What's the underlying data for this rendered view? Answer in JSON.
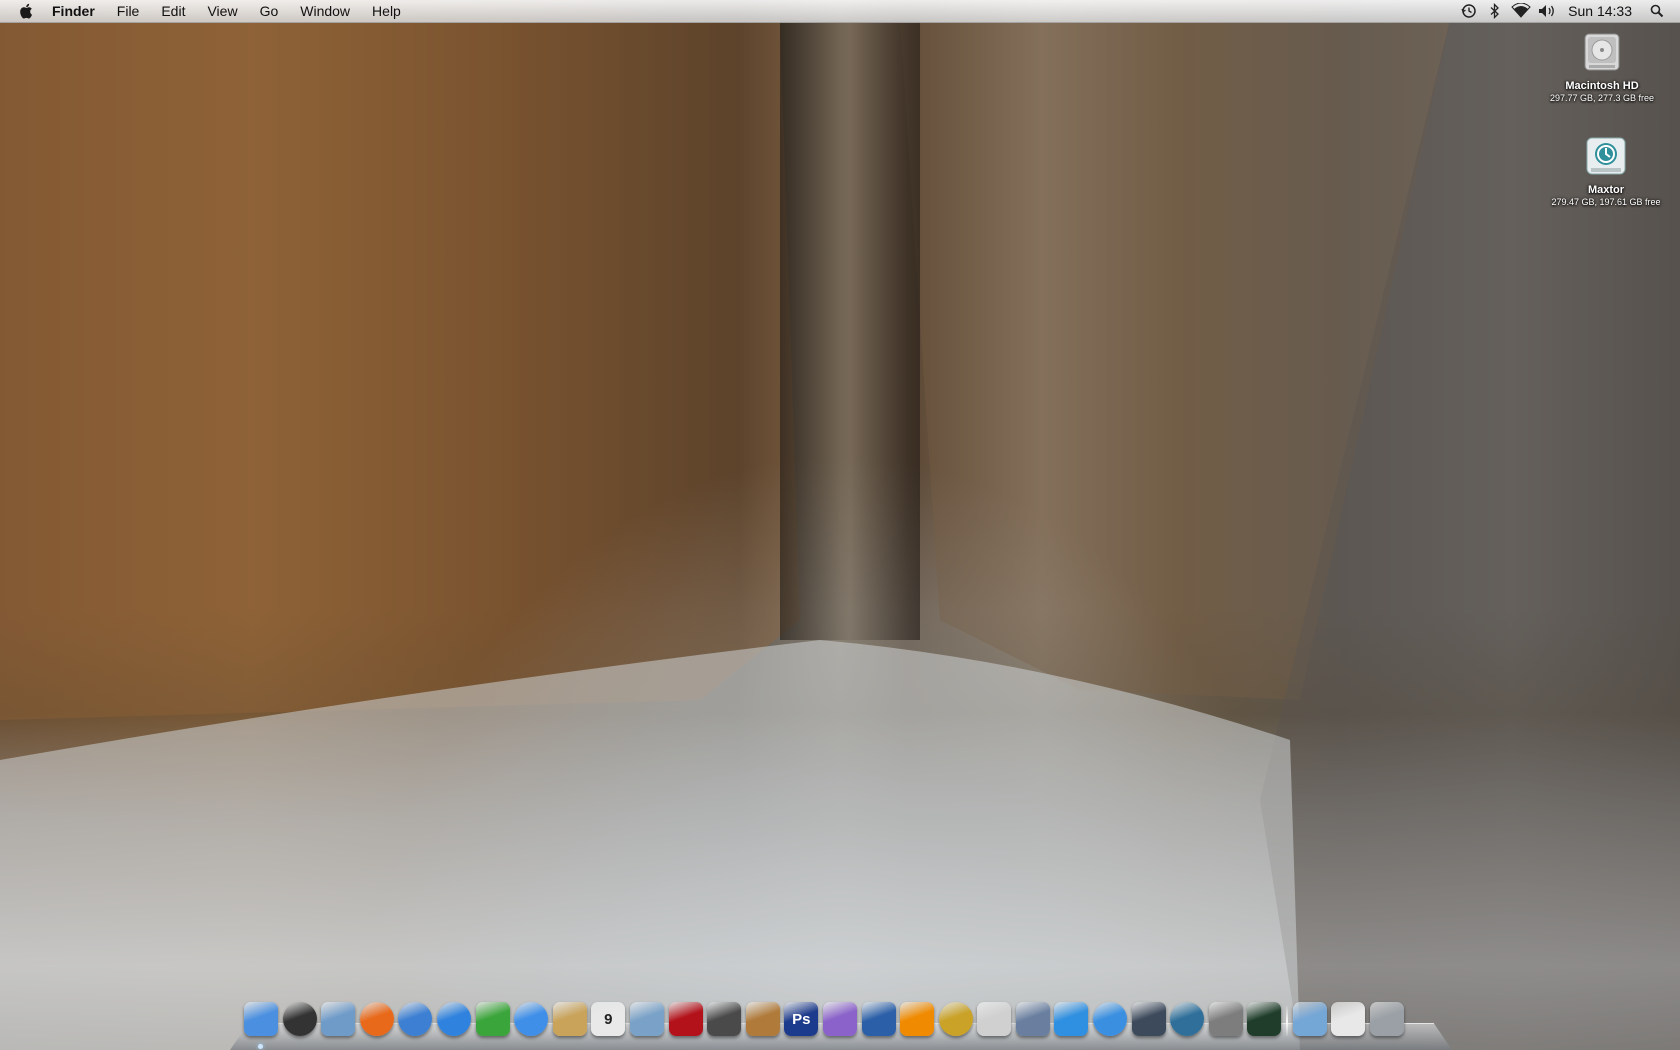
{
  "menubar": {
    "apple_icon": "apple-logo-icon",
    "app_name": "Finder",
    "menus": [
      "File",
      "Edit",
      "View",
      "Go",
      "Window",
      "Help"
    ],
    "status_icons": [
      "time-machine-icon",
      "bluetooth-icon",
      "wifi-icon",
      "volume-icon"
    ],
    "clock": "Sun 14:33",
    "spotlight_icon": "spotlight-search-icon"
  },
  "desktop": {
    "wallpaper": "narrows-canyon-river",
    "drives": [
      {
        "name": "Macintosh HD",
        "info": "297.77 GB, 277.3 GB free",
        "icon": "hard-drive-icon"
      },
      {
        "name": "Maxtor",
        "info": "279.47 GB, 197.61 GB free",
        "icon": "time-machine-drive-icon"
      }
    ]
  },
  "dock": {
    "items": [
      {
        "icon": "finder-icon",
        "color": "#4a8fe0"
      },
      {
        "icon": "dashboard-icon",
        "color": "#333333"
      },
      {
        "icon": "mail-stamp-icon",
        "color": "#6f9bc9"
      },
      {
        "icon": "firefox-icon",
        "color": "#e8691a"
      },
      {
        "icon": "network-compass-icon",
        "color": "#3c7fd3"
      },
      {
        "icon": "safari-icon",
        "color": "#2f82dd"
      },
      {
        "icon": "adium-duck-icon",
        "color": "#3aa53a"
      },
      {
        "icon": "ichat-icon",
        "color": "#3f8fe8"
      },
      {
        "icon": "address-book-icon",
        "color": "#c9a35a"
      },
      {
        "icon": "ical-icon",
        "color": "#e9e9e9",
        "text": "9"
      },
      {
        "icon": "iphoto-icon",
        "color": "#7aa2c8"
      },
      {
        "icon": "photo-booth-icon",
        "color": "#b3121a"
      },
      {
        "icon": "imovie-star-icon",
        "color": "#4a4a4a"
      },
      {
        "icon": "preview-icon",
        "color": "#b07a3a"
      },
      {
        "icon": "photoshop-icon",
        "color": "#1d3b8c",
        "text": "Ps"
      },
      {
        "icon": "textedit-icon",
        "color": "#8a62c9"
      },
      {
        "icon": "final-cut-icon",
        "color": "#2b5fa8"
      },
      {
        "icon": "vlc-cone-icon",
        "color": "#f08a00"
      },
      {
        "icon": "dvd-player-icon",
        "color": "#c9a227"
      },
      {
        "icon": "script-editor-icon",
        "color": "#d0d0d0"
      },
      {
        "icon": "keynote-icon",
        "color": "#6a7fa0"
      },
      {
        "icon": "numbers-icon",
        "color": "#2f8fe0"
      },
      {
        "icon": "itunes-icon",
        "color": "#3a8fe0"
      },
      {
        "icon": "expose-icon",
        "color": "#3d4a5c"
      },
      {
        "icon": "time-machine-icon",
        "color": "#2f6f9a"
      },
      {
        "icon": "system-preferences-icon",
        "color": "#7d7d7d"
      },
      {
        "icon": "activity-monitor-icon",
        "color": "#1f3d2a"
      },
      {
        "icon": "applications-folder-icon",
        "color": "#74a6d6"
      },
      {
        "icon": "documents-stack-icon",
        "color": "#e8e8e8"
      },
      {
        "icon": "trash-icon",
        "color": "#9aa0a6"
      }
    ]
  }
}
